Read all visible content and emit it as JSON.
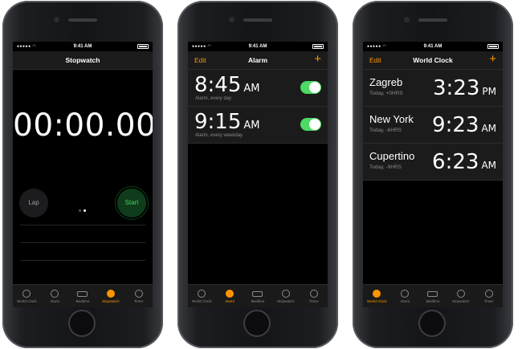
{
  "status": {
    "time": "9:41 AM"
  },
  "tabs": [
    "World Clock",
    "Alarm",
    "Bedtime",
    "Stopwatch",
    "Timer"
  ],
  "stopwatch": {
    "title": "Stopwatch",
    "time": "00:00.00",
    "lap_label": "Lap",
    "start_label": "Start",
    "active_tab": "Stopwatch"
  },
  "alarm": {
    "title": "Alarm",
    "edit_label": "Edit",
    "add_label": "+",
    "items": [
      {
        "time": "8:45",
        "ampm": "AM",
        "label": "Alarm, every day",
        "enabled": true
      },
      {
        "time": "9:15",
        "ampm": "AM",
        "label": "Alarm, every weekday",
        "enabled": true
      }
    ],
    "active_tab": "Alarm"
  },
  "worldclock": {
    "title": "World Clock",
    "edit_label": "Edit",
    "add_label": "+",
    "items": [
      {
        "city": "Zagreb",
        "offset": "Today, +0HRS",
        "time": "3:23",
        "ampm": "PM"
      },
      {
        "city": "New York",
        "offset": "Today, -6HRS",
        "time": "9:23",
        "ampm": "AM"
      },
      {
        "city": "Cupertino",
        "offset": "Today, -9HRS",
        "time": "6:23",
        "ampm": "AM"
      }
    ],
    "active_tab": "World Clock"
  },
  "colors": {
    "accent": "#ff9500",
    "toggle_on": "#4cd964",
    "start_green": "#45d35e"
  }
}
